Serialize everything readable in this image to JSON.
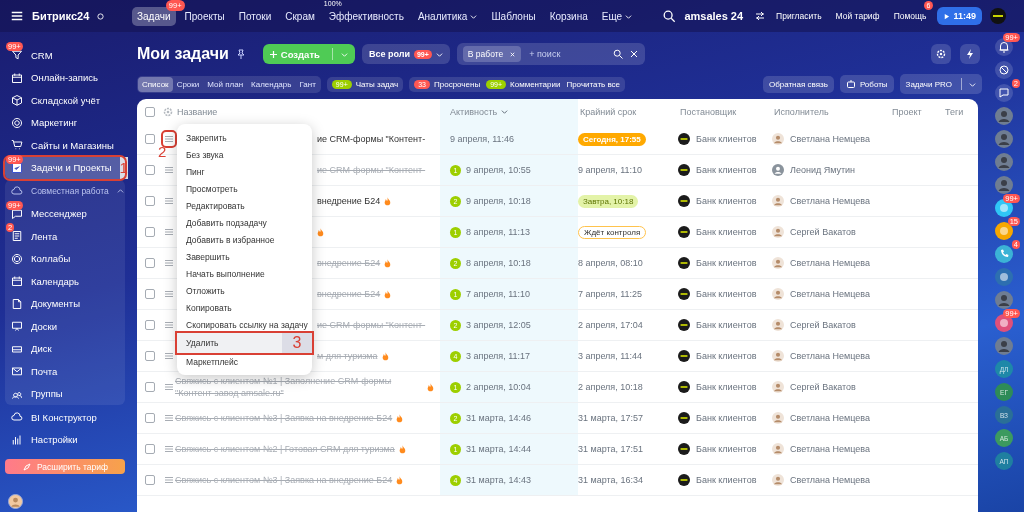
{
  "topbar": {
    "logo": "Битрикс24",
    "nav": [
      {
        "label": "Задачи",
        "selected": true,
        "badge": "99+"
      },
      {
        "label": "Проекты",
        "selected": false
      },
      {
        "label": "Потоки",
        "selected": false
      },
      {
        "label": "Скрам",
        "selected": false
      },
      {
        "label": "Эффективность",
        "selected": false,
        "superscript": "100%"
      },
      {
        "label": "Аналитика",
        "selected": false,
        "dropdown": true
      },
      {
        "label": "Шаблоны",
        "selected": false
      },
      {
        "label": "Корзина",
        "selected": false
      },
      {
        "label": "Еще",
        "selected": false,
        "dropdown": true
      }
    ],
    "portal": "amsales 24",
    "actions": [
      {
        "label": "Пригласить"
      },
      {
        "label": "Мой тариф"
      },
      {
        "label": "Помощь",
        "badge": "6"
      }
    ],
    "clock": "11:49"
  },
  "sidebar": {
    "items": [
      {
        "label": "CRM",
        "selected": false,
        "badge": "99+"
      },
      {
        "label": "Онлайн-запись",
        "selected": false
      },
      {
        "label": "Складской учёт",
        "selected": false
      },
      {
        "label": "Маркетинг",
        "selected": false
      },
      {
        "label": "Сайты и Магазины",
        "selected": false
      },
      {
        "label": "Задачи и Проекты",
        "selected": true,
        "badge": "99+",
        "callout": "1"
      },
      {
        "label": "Совместная работа",
        "kind": "group",
        "expanded": true,
        "selected": false,
        "children": [
          {
            "label": "Мессенджер",
            "selected": false,
            "badge": "99+"
          },
          {
            "label": "Лента",
            "selected": false,
            "badge": "2"
          },
          {
            "label": "Коллабы",
            "selected": false
          },
          {
            "label": "Календарь",
            "selected": false
          },
          {
            "label": "Документы",
            "selected": false
          },
          {
            "label": "Доски",
            "selected": false
          },
          {
            "label": "Диск",
            "selected": false
          },
          {
            "label": "Почта",
            "selected": false
          },
          {
            "label": "Группы",
            "selected": false
          }
        ]
      },
      {
        "label": "BI Конструктор",
        "selected": false
      },
      {
        "label": "Настройки",
        "selected": false
      }
    ],
    "upgrade_button": "Расширить тариф"
  },
  "page": {
    "title": "Мои задачи",
    "create_button": "Создать",
    "roles_button": {
      "label": "Все роли",
      "badge": "99+"
    },
    "search": {
      "tag": "В работе",
      "placeholder": "+ поиск"
    },
    "views": [
      {
        "label": "Список",
        "selected": true
      },
      {
        "label": "Сроки",
        "selected": false
      },
      {
        "label": "Мой план",
        "selected": false
      },
      {
        "label": "Календарь",
        "selected": false
      },
      {
        "label": "Гант",
        "selected": false
      }
    ],
    "chat_counter": {
      "count": "99+",
      "label": "Чаты задач",
      "color": "#9dcf00"
    },
    "counters": [
      {
        "count": "33",
        "label": "Просрочены",
        "color": "#ff5752"
      },
      {
        "count": "99+",
        "label": "Комментарии",
        "color": "#9dcf00"
      }
    ],
    "read_all": "Прочитать все",
    "feedback_button": "Обратная связь",
    "robots_button": "Роботы",
    "pro_button": "Задачи PRO"
  },
  "table": {
    "all_checked": false,
    "columns": [
      {
        "label": "Название",
        "sorted": false
      },
      {
        "label": "Активность",
        "sorted": true
      },
      {
        "label": "Крайний срок",
        "sorted": false
      },
      {
        "label": "Постановщик",
        "sorted": false
      },
      {
        "label": "Исполнитель",
        "sorted": false
      },
      {
        "label": "Проект",
        "sorted": false
      },
      {
        "label": "Теги",
        "sorted": false
      }
    ],
    "rows": [
      {
        "checked": false,
        "covered": true,
        "completed": false,
        "hot": false,
        "title": "ие CRM-формы \"Контент-",
        "activity": "9 апреля, 11:46",
        "deadline": {
          "text": "Сегодня, 17:55",
          "kind": "today"
        },
        "creator": "Банк клиентов",
        "assignee": {
          "name": "Светлана Немцева",
          "kind": "photo"
        },
        "callout": "2"
      },
      {
        "checked": false,
        "covered": true,
        "completed": true,
        "hot": false,
        "title": "ие CRM-формы \"Контент-",
        "counter": "1",
        "activity": "9 апреля, 10:55",
        "deadline": {
          "text": "9 апреля, 11:10",
          "kind": "plain"
        },
        "creator": "Банк клиентов",
        "assignee": {
          "name": "Леонид Ямутин",
          "kind": "placeholder"
        }
      },
      {
        "checked": false,
        "covered": true,
        "completed": false,
        "hot": true,
        "title": "внедрение Б24",
        "counter": "2",
        "activity": "9 апреля, 10:18",
        "deadline": {
          "text": "Завтра, 10:18",
          "kind": "tomorrow"
        },
        "creator": "Банк клиентов",
        "assignee": {
          "name": "Светлана Немцева",
          "kind": "photo"
        }
      },
      {
        "checked": false,
        "covered": true,
        "hot": true,
        "counter": "1",
        "activity": "8 апреля, 11:13",
        "deadline": {
          "text": "Ждёт контроля",
          "kind": "control"
        },
        "creator": "Банк клиентов",
        "assignee": {
          "name": "Сергей Вакатов",
          "kind": "photo"
        }
      },
      {
        "checked": false,
        "covered": true,
        "completed": true,
        "hot": true,
        "title": "внедрение Б24",
        "counter": "2",
        "activity": "8 апреля, 10:18",
        "deadline": {
          "text": "8 апреля, 08:10",
          "kind": "plain"
        },
        "creator": "Банк клиентов",
        "assignee": {
          "name": "Светлана Немцева",
          "kind": "photo"
        }
      },
      {
        "checked": false,
        "covered": true,
        "completed": true,
        "hot": true,
        "title": "внедрение Б24",
        "counter": "1",
        "activity": "7 апреля, 11:10",
        "deadline": {
          "text": "7 апреля, 11:25",
          "kind": "plain"
        },
        "creator": "Банк клиентов",
        "assignee": {
          "name": "Светлана Немцева",
          "kind": "photo"
        }
      },
      {
        "checked": false,
        "covered": true,
        "completed": true,
        "hot": false,
        "title": "ие CRM-формы \"Контент-",
        "counter": "2",
        "activity": "3 апреля, 12:05",
        "deadline": {
          "text": "2 апреля, 17:04",
          "kind": "plain"
        },
        "creator": "Банк клиентов",
        "assignee": {
          "name": "Сергей Вакатов",
          "kind": "photo"
        }
      },
      {
        "checked": false,
        "covered": true,
        "completed": true,
        "hot": true,
        "title": "м для туризма",
        "counter": "4",
        "activity": "3 апреля, 11:17",
        "deadline": {
          "text": "3 апреля, 11:44",
          "kind": "plain"
        },
        "creator": "Банк клиентов",
        "assignee": {
          "name": "Светлана Немцева",
          "kind": "photo"
        }
      },
      {
        "checked": false,
        "covered": false,
        "completed": true,
        "hot": true,
        "title": "Свяжись с клиентом №1 | Заполнение CRM-формы \"Контент-завод amsale.ru\"",
        "counter": "1",
        "activity": "2 апреля, 10:04",
        "deadline": {
          "text": "2 апреля, 10:18",
          "kind": "plain"
        },
        "creator": "Банк клиентов",
        "assignee": {
          "name": "Сергей Вакатов",
          "kind": "photo"
        }
      },
      {
        "checked": false,
        "covered": false,
        "completed": true,
        "hot": true,
        "title": "Свяжись с клиентом №3 | Заявка на внедрение Б24",
        "counter": "2",
        "activity": "31 марта, 14:46",
        "deadline": {
          "text": "31 марта, 17:57",
          "kind": "plain"
        },
        "creator": "Банк клиентов",
        "assignee": {
          "name": "Светлана Немцева",
          "kind": "photo"
        }
      },
      {
        "checked": false,
        "covered": false,
        "completed": true,
        "hot": true,
        "title": "Свяжись с клиентом №2 | Готовая CRM для туризма",
        "counter": "1",
        "activity": "31 марта, 14:44",
        "deadline": {
          "text": "31 марта, 17:51",
          "kind": "plain"
        },
        "creator": "Банк клиентов",
        "assignee": {
          "name": "Светлана Немцева",
          "kind": "photo"
        }
      },
      {
        "checked": false,
        "covered": false,
        "completed": true,
        "hot": true,
        "title": "Свяжись с клиентом №3 | Заявка на внедрение Б24",
        "counter": "4",
        "activity": "31 марта, 14:43",
        "deadline": {
          "text": "31 марта, 16:34",
          "kind": "plain"
        },
        "creator": "Банк клиентов",
        "assignee": {
          "name": "Светлана Немцева",
          "kind": "photo"
        }
      }
    ]
  },
  "context_menu": {
    "items": [
      {
        "label": "Закрепить",
        "selected": false
      },
      {
        "label": "Без звука",
        "selected": false
      },
      {
        "label": "Пинг",
        "selected": false
      },
      {
        "label": "Просмотреть",
        "selected": false
      },
      {
        "label": "Редактировать",
        "selected": false
      },
      {
        "label": "Добавить подзадачу",
        "selected": false
      },
      {
        "label": "Добавить в избранное",
        "selected": false
      },
      {
        "label": "Завершить",
        "selected": false
      },
      {
        "label": "Начать выполнение",
        "selected": false
      },
      {
        "label": "Отложить",
        "selected": false
      },
      {
        "label": "Копировать",
        "selected": false
      },
      {
        "label": "Скопировать ссылку на задачу",
        "selected": false
      },
      {
        "label": "Удалить",
        "selected": true,
        "callout": "3"
      },
      {
        "label": "Маркетплейс",
        "selected": false
      }
    ]
  },
  "right_rail": [
    {
      "kind": "bell",
      "badge": "99+"
    },
    {
      "kind": "network"
    },
    {
      "kind": "chat",
      "badge": "2"
    },
    {
      "kind": "avatar"
    },
    {
      "kind": "avatar"
    },
    {
      "kind": "avatar"
    },
    {
      "kind": "avatar"
    },
    {
      "kind": "app",
      "color": "#2fc6f6",
      "badge": "99+"
    },
    {
      "kind": "app",
      "color": "#f7a700",
      "badge": "15"
    },
    {
      "kind": "phone",
      "color": "#3bb3d6",
      "badge": "4"
    },
    {
      "kind": "app",
      "color": "#2d6fb0"
    },
    {
      "kind": "avatar"
    },
    {
      "kind": "app",
      "color": "#e0507a",
      "badge": "99+"
    },
    {
      "kind": "avatar"
    },
    {
      "kind": "initials",
      "initials": "ДЛ",
      "color": "#1e88a8"
    },
    {
      "kind": "initials",
      "initials": "ЕГ",
      "color": "#2e8b57"
    },
    {
      "kind": "initials",
      "initials": "ВЗ",
      "color": "#2a6f97"
    },
    {
      "kind": "initials",
      "initials": "АБ",
      "color": "#3c9a5f"
    },
    {
      "kind": "initials",
      "initials": "АП",
      "color": "#1f7fa0"
    }
  ]
}
